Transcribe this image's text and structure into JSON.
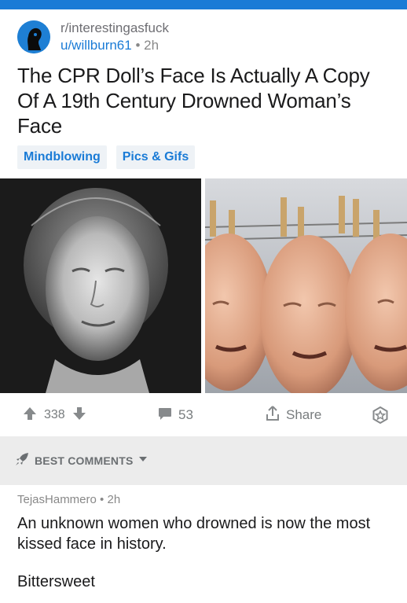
{
  "post": {
    "subreddit": "r/interestingasfuck",
    "author": "u/willburn61",
    "separator": "•",
    "age": "2h",
    "title": "The CPR Doll’s Face Is Actually A Copy Of A 19th Century Drowned Woman’s Face",
    "flairs": [
      "Mindblowing",
      "Pics & Gifs"
    ],
    "score": "338",
    "comment_count": "53",
    "share_label": "Share"
  },
  "sort": {
    "label": "BEST COMMENTS"
  },
  "comment": {
    "author": "TejasHammero",
    "separator": "•",
    "age": "2h",
    "text": "An unknown women who drowned is now the most kissed face in history.",
    "text2": "Bittersweet"
  },
  "colors": {
    "accent": "#1a7bd6",
    "sort_bar_bg": "#ececec",
    "flair_bg": "#eef2f6"
  },
  "icons": {
    "upvote": "arrow-up-icon",
    "downvote": "arrow-down-icon",
    "comments": "speech-bubble-icon",
    "share": "share-icon",
    "award": "star-award-icon",
    "sort": "rocket-icon",
    "dropdown": "caret-down-icon"
  }
}
